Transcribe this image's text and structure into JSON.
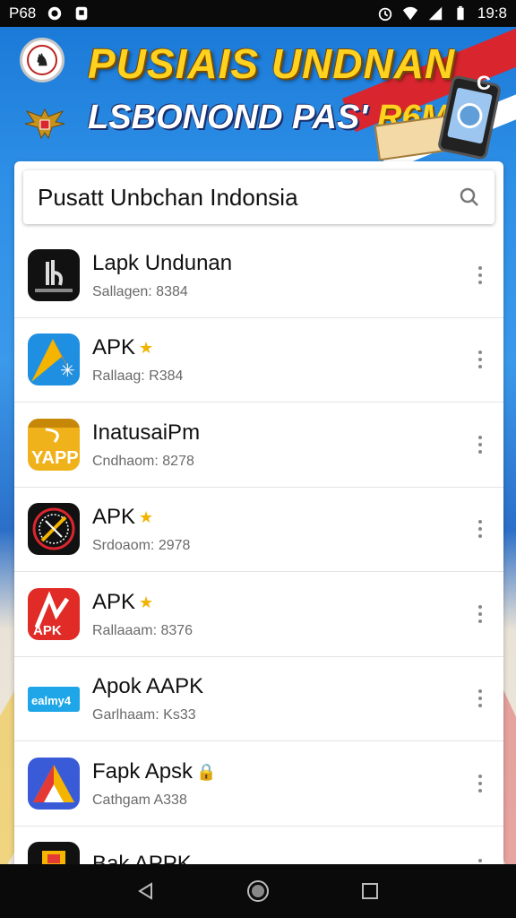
{
  "status_bar": {
    "time_left": "P68",
    "time_right": "19:8"
  },
  "banner": {
    "title": "PUSIAIS UNDNAN",
    "subtitle_main": "LSBONOND PAS'",
    "subtitle_accent": "R6M! !",
    "close": "C"
  },
  "search": {
    "text": "Pusatt Unbchan Indonsia"
  },
  "apps": [
    {
      "name": "Lapk Undunan",
      "sub": "Sallagen: 8384",
      "badge": "",
      "icon": "dark-logo-icon",
      "color": "#111111"
    },
    {
      "name": "APK",
      "sub": "Rallaag: R384",
      "badge": "★",
      "icon": "triangle-star-icon",
      "color": "#1e8fe1"
    },
    {
      "name": "InatusaiPm",
      "sub": "Cndhaom: 8278",
      "badge": "",
      "icon": "yapp-icon",
      "color": "#f0b21b"
    },
    {
      "name": "APK",
      "sub": "Srdoaom: 2978",
      "badge": "★",
      "icon": "compass-icon",
      "color": "#111111"
    },
    {
      "name": "APK",
      "sub": "Rallaaam: 8376",
      "badge": "★",
      "icon": "red-apk-icon",
      "color": "#e02b27"
    },
    {
      "name": "Apok AAPK",
      "sub": "Garlhaam: Ks33",
      "badge": "",
      "icon": "blue-tag-icon",
      "color": "#1ea6e8"
    },
    {
      "name": "Fapk Apsk",
      "sub": "Cathgam A338",
      "badge": "🔒",
      "icon": "triangle-multicolor-icon",
      "color": "#3a5bd8"
    },
    {
      "name": "Bak APPK",
      "sub": "",
      "badge": "",
      "icon": "folder-icon",
      "color": "#111111"
    }
  ]
}
